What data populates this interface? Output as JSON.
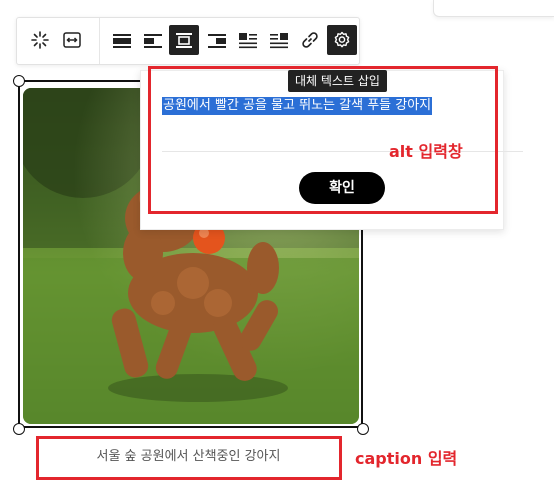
{
  "toolbar": {
    "buttons": [
      {
        "name": "sparkle-icon"
      },
      {
        "name": "resize-width-icon"
      },
      {
        "name": "align-full-icon"
      },
      {
        "name": "align-left-icon"
      },
      {
        "name": "align-center-icon",
        "active": true
      },
      {
        "name": "align-right-icon"
      },
      {
        "name": "wrap-left-icon"
      },
      {
        "name": "wrap-right-icon"
      },
      {
        "name": "link-icon"
      },
      {
        "name": "gear-icon",
        "active": true
      }
    ]
  },
  "alt_popup": {
    "tooltip": "대체 텍스트 삽입",
    "input_value": "공원에서 빨간 공을 물고 뛰노는 갈색 푸들 강아지",
    "confirm_label": "확인"
  },
  "annotations": {
    "alt_label": "alt 입력창",
    "caption_label": "caption 입력"
  },
  "image": {
    "alt": "공원에서 빨간 공을 물고 뛰노는 갈색 푸들 강아지"
  },
  "caption": {
    "value": "서울 숲 공원에서 산책중인 강아지"
  },
  "colors": {
    "annotation_red": "#e3262d",
    "selection_blue": "#2b6fd6"
  }
}
